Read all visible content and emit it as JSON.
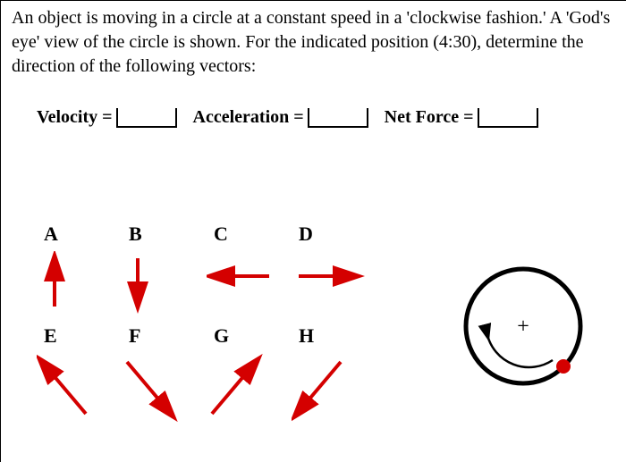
{
  "question": "An object is moving in a circle at a constant speed in a 'clockwise fashion.' A 'God's eye' view of the circle is shown. For the indicated position (4:30), determine the direction of the following vectors:",
  "fields": {
    "velocity_label": "Velocity =",
    "acceleration_label": "Acceleration =",
    "netforce_label": "Net Force =",
    "velocity_value": "",
    "acceleration_value": "",
    "netforce_value": ""
  },
  "options": {
    "A": "A",
    "B": "B",
    "C": "C",
    "D": "D",
    "E": "E",
    "F": "F",
    "G": "G",
    "H": "H"
  },
  "arrow_directions": {
    "A": "up",
    "B": "down",
    "C": "left",
    "D": "right",
    "E": "up-left",
    "F": "down-right",
    "G": "up-right",
    "H": "down-left"
  },
  "diagram": {
    "motion": "clockwise",
    "marker_position": "4:30",
    "center_symbol": "+"
  },
  "colors": {
    "arrow": "#d40000",
    "text": "#000000",
    "circle": "#000000",
    "dot": "#d40000"
  }
}
